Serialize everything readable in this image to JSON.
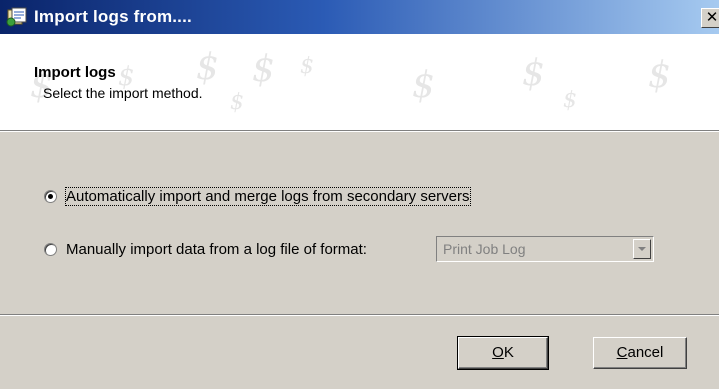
{
  "window": {
    "title": "Import logs from....",
    "icon": "import-app-icon",
    "close_symbol": "✕"
  },
  "header": {
    "title": "Import logs",
    "subtitle": "Select the import method.",
    "watermark_glyph": "$"
  },
  "options": [
    {
      "label": "Automatically import and merge logs from secondary servers",
      "selected": true
    },
    {
      "label": "Manually import data from a log file of format:",
      "selected": false
    }
  ],
  "format_select": {
    "value": "Print Job Log",
    "enabled": false
  },
  "buttons": {
    "ok_mnemonic": "O",
    "ok_rest": "K",
    "cancel_mnemonic": "C",
    "cancel_rest": "ancel"
  }
}
